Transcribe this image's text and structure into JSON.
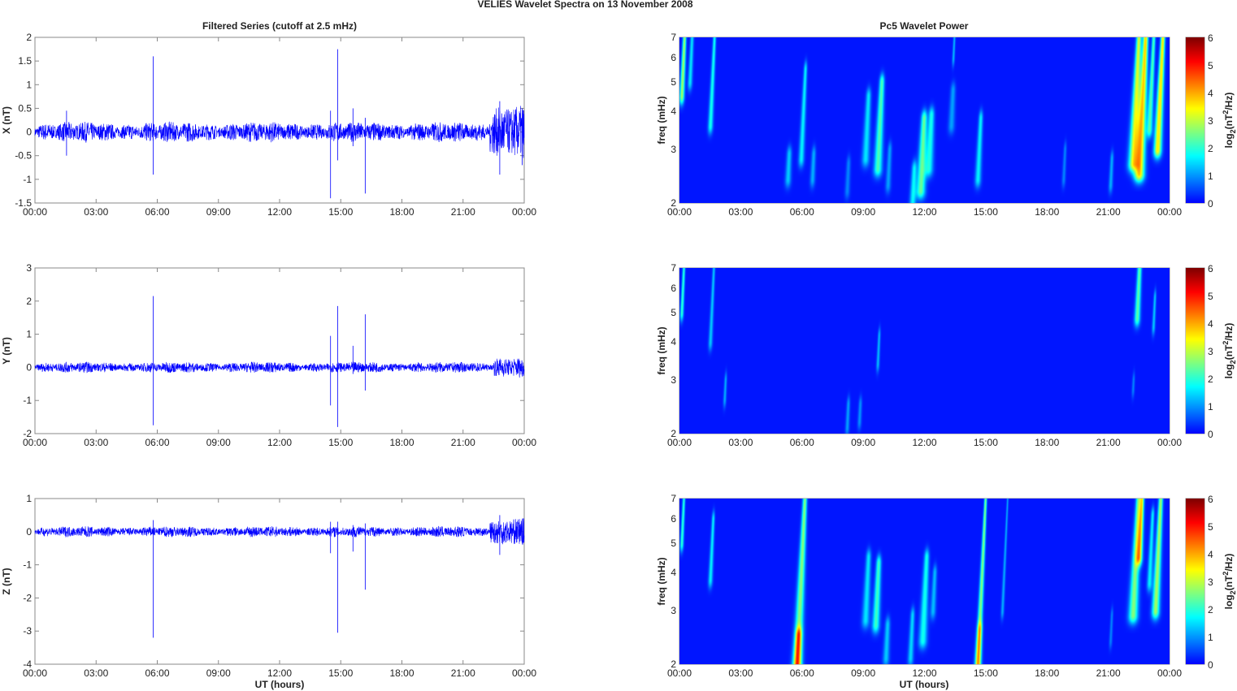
{
  "chart_data": {
    "title": "VELIES Wavelet Spectra on 13 November  2008",
    "left_title": "Filtered Series (cutoff at 2.5 mHz)",
    "right_title": "Pc5 Wavelet Power",
    "xlabel": "UT (hours)",
    "xticks": [
      "00:00",
      "03:00",
      "06:00",
      "09:00",
      "12:00",
      "15:00",
      "18:00",
      "21:00",
      "00:00"
    ],
    "xlim": [
      0,
      24
    ],
    "series": [
      {
        "type": "line",
        "name": "X",
        "ylabel": "X (nT)",
        "ylim": [
          -1.5,
          2
        ],
        "yticks": [
          "-1.5",
          "-1",
          "-0.5",
          "0",
          "0.5",
          "1",
          "1.5",
          "2"
        ],
        "noise": 0.13,
        "spikes": [
          [
            1.55,
            0.45,
            -0.5
          ],
          [
            5.8,
            1.6,
            -0.9
          ],
          [
            14.5,
            0.45,
            -1.4
          ],
          [
            14.85,
            1.75,
            -0.6
          ],
          [
            15.6,
            0.5,
            -0.3
          ],
          [
            16.2,
            0.3,
            -1.3
          ],
          [
            22.8,
            0.65,
            -0.9
          ],
          [
            23.9,
            0.5,
            -0.7
          ]
        ],
        "burst": [
          22.3,
          24,
          0.35
        ]
      },
      {
        "type": "line",
        "name": "Y",
        "ylabel": "Y (nT)",
        "ylim": [
          -2,
          3
        ],
        "yticks": [
          "-2",
          "-1",
          "0",
          "1",
          "2",
          "3"
        ],
        "noise": 0.1,
        "spikes": [
          [
            5.8,
            2.15,
            -1.75
          ],
          [
            14.5,
            0.95,
            -1.15
          ],
          [
            14.85,
            1.85,
            -1.8
          ],
          [
            15.6,
            0.65,
            -0.2
          ],
          [
            16.2,
            1.6,
            -0.7
          ]
        ],
        "burst": [
          22.5,
          24,
          0.15
        ]
      },
      {
        "type": "line",
        "name": "Z",
        "ylabel": "Z (nT)",
        "ylim": [
          -4,
          1
        ],
        "yticks": [
          "-4",
          "-3",
          "-2",
          "-1",
          "0",
          "1"
        ],
        "noise": 0.1,
        "spikes": [
          [
            5.8,
            0.35,
            -3.2
          ],
          [
            14.5,
            0.3,
            -0.65
          ],
          [
            14.85,
            0.3,
            -3.05
          ],
          [
            15.6,
            0.2,
            -0.6
          ],
          [
            16.2,
            0.25,
            -1.75
          ],
          [
            22.8,
            0.5,
            -0.7
          ]
        ],
        "burst": [
          22.3,
          24,
          0.25
        ]
      }
    ],
    "spectra": {
      "type": "heatmap",
      "ylabel": "freq (mHz)",
      "ylim": [
        2,
        7
      ],
      "yticks": [
        "2",
        "3",
        "4",
        "5",
        "6",
        "7"
      ],
      "colorbar": {
        "label": "log2(nT2/Hz)",
        "range": [
          0,
          6
        ],
        "ticks": [
          "0",
          "1",
          "2",
          "3",
          "4",
          "5",
          "6"
        ]
      },
      "panels": [
        [
          [
            0.1,
            4.5,
            7,
            0.08,
            2.8
          ],
          [
            0.5,
            5,
            7,
            0.08,
            1.5
          ],
          [
            1.5,
            3.6,
            7,
            0.07,
            1.8
          ],
          [
            5.3,
            2.4,
            2.9,
            0.12,
            1.3
          ],
          [
            5.95,
            2.8,
            5.5,
            0.08,
            1.6
          ],
          [
            6.5,
            2.4,
            2.9,
            0.1,
            1.1
          ],
          [
            8.2,
            2.2,
            2.7,
            0.1,
            0.8
          ],
          [
            9.1,
            2.8,
            4.5,
            0.12,
            1.5
          ],
          [
            9.7,
            2.6,
            5,
            0.12,
            2.2
          ],
          [
            10.2,
            2.3,
            3,
            0.1,
            1
          ],
          [
            11.4,
            2.0,
            2.6,
            0.12,
            1.6
          ],
          [
            11.8,
            2.2,
            3.8,
            0.14,
            2.4
          ],
          [
            12.2,
            2.6,
            3.9,
            0.14,
            1.8
          ],
          [
            13.3,
            3.6,
            4.7,
            0.12,
            1.0
          ],
          [
            13.4,
            6,
            7,
            0.05,
            1.2
          ],
          [
            14.6,
            2.4,
            3.8,
            0.1,
            1.6
          ],
          [
            18.8,
            2.4,
            3,
            0.07,
            0.8
          ],
          [
            21.1,
            2.3,
            2.8,
            0.08,
            1.1
          ],
          [
            22.2,
            2.7,
            7,
            0.12,
            3.2
          ],
          [
            22.5,
            2.5,
            7,
            0.12,
            3.8
          ],
          [
            23.0,
            3.5,
            7,
            0.08,
            2.2
          ],
          [
            23.4,
            3.0,
            7,
            0.1,
            3.6
          ]
        ],
        [
          [
            0.1,
            5,
            7,
            0.06,
            2.0
          ],
          [
            1.5,
            4,
            7,
            0.06,
            1.3
          ],
          [
            2.2,
            2.6,
            3.0,
            0.06,
            1.1
          ],
          [
            8.2,
            2.1,
            2.5,
            0.08,
            1.0
          ],
          [
            8.8,
            2.2,
            2.5,
            0.08,
            0.9
          ],
          [
            9.7,
            3.4,
            4.2,
            0.06,
            1.2
          ],
          [
            22.2,
            2.8,
            3.0,
            0.06,
            0.8
          ],
          [
            22.4,
            4.8,
            7,
            0.1,
            2.3
          ],
          [
            23.2,
            4.5,
            5.6,
            0.06,
            1.3
          ]
        ],
        [
          [
            0.1,
            5,
            7,
            0.06,
            2.0
          ],
          [
            1.5,
            3.8,
            6,
            0.07,
            1.6
          ],
          [
            5.75,
            2.0,
            7,
            0.1,
            2.6
          ],
          [
            5.75,
            2.0,
            2.5,
            0.15,
            2.6
          ],
          [
            9.1,
            2.8,
            4.5,
            0.12,
            1.5
          ],
          [
            9.6,
            2.7,
            4.3,
            0.12,
            2.1
          ],
          [
            10.1,
            2.1,
            2.7,
            0.12,
            1.3
          ],
          [
            11.3,
            2.1,
            2.9,
            0.1,
            1.4
          ],
          [
            11.9,
            2.4,
            4.5,
            0.12,
            1.8
          ],
          [
            12.4,
            3.0,
            4.0,
            0.1,
            1.2
          ],
          [
            14.6,
            2.0,
            7,
            0.06,
            2.6
          ],
          [
            14.6,
            2.0,
            2.6,
            0.12,
            1.8
          ],
          [
            15.8,
            3.0,
            7,
            0.04,
            1.1
          ],
          [
            21.1,
            2.4,
            2.9,
            0.06,
            0.8
          ],
          [
            22.2,
            2.9,
            7,
            0.12,
            2.6
          ],
          [
            22.5,
            4.5,
            7,
            0.1,
            3.4
          ],
          [
            23.0,
            3.7,
            6.2,
            0.08,
            1.6
          ],
          [
            23.3,
            3.0,
            7,
            0.1,
            2.8
          ]
        ]
      ]
    }
  }
}
